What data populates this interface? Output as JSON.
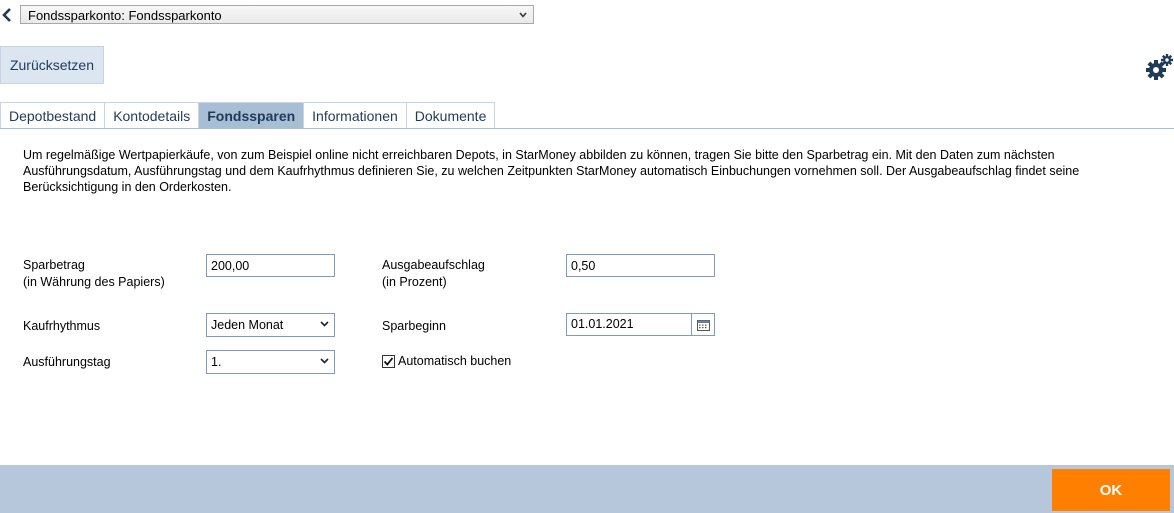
{
  "account_select": {
    "value": "Fondssparkonto: Fondssparkonto"
  },
  "toolbar": {
    "reset_label": "Zurücksetzen"
  },
  "tabs": [
    {
      "label": "Depotbestand",
      "active": false
    },
    {
      "label": "Kontodetails",
      "active": false
    },
    {
      "label": "Fondssparen",
      "active": true
    },
    {
      "label": "Informationen",
      "active": false
    },
    {
      "label": "Dokumente",
      "active": false
    }
  ],
  "intro": {
    "text": "Um regelmäßige Wertpapierkäufe, von zum Beispiel online nicht erreichbaren Depots, in StarMoney abbilden zu können, tragen Sie bitte den Sparbetrag ein. Mit den Daten zum nächsten Ausführungsdatum, Ausführungstag und dem Kaufrhythmus definieren Sie, zu welchen Zeitpunkten StarMoney automatisch Einbuchungen vornehmen soll. Der Ausgabeaufschlag findet seine Berücksichtigung in den Orderkosten."
  },
  "form": {
    "sparbetrag": {
      "label_1": "Sparbetrag",
      "label_2": "(in Währung des Papiers)",
      "value": "200,00"
    },
    "ausgabeaufschlag": {
      "label_1": "Ausgabeaufschlag",
      "label_2": "(in Prozent)",
      "value": "0,50"
    },
    "kaufrhythmus": {
      "label": "Kaufrhythmus",
      "value": "Jeden Monat"
    },
    "sparbeginn": {
      "label": "Sparbeginn",
      "value": "01.01.2021"
    },
    "ausfuehrungstag": {
      "label": "Ausführungstag",
      "value": "1."
    },
    "automatisch": {
      "label": "Automatisch buchen",
      "checked": true
    }
  },
  "footer": {
    "ok_label": "OK"
  },
  "colors": {
    "accent": "#ff7f00",
    "footer_bg": "#b7c7db",
    "tab_active": "#a8bed4",
    "button_bg": "#dce6f1"
  },
  "icons": {
    "back": "chevron-left-icon",
    "dropdown": "chevron-down-icon",
    "settings": "gears-icon",
    "calendar": "calendar-icon",
    "checkbox": "checkmark-icon"
  }
}
